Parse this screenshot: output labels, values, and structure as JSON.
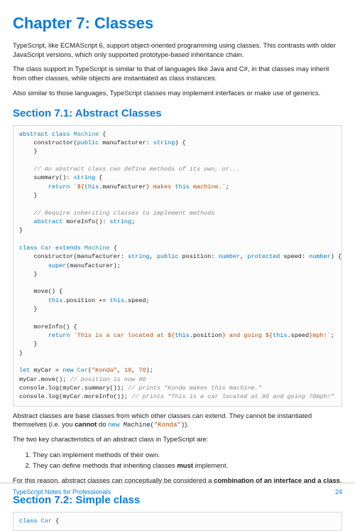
{
  "chapter_title": "Chapter 7: Classes",
  "p1": "TypeScript, like ECMAScript 6, support object-oriented programming using classes. This contrasts with older JavaScript versions, which only supported prototype-based inheritance chain.",
  "p2": "The class support in TypeScript is similar to that of languages like Java and C#, in that classes may inherit from other classes, while objects are instantiated as class instances.",
  "p3": "Also similar to those languages, TypeScript classes may implement interfaces or make use of generics.",
  "section1": "Section 7.1: Abstract Classes",
  "p4a": "Abstract classes are base classes from which other classes can extend. They cannot be instantiated themselves (i.e. you ",
  "p4b": "cannot",
  "p4c": " do ",
  "p4d_kw1": "new",
  "p4d_rest": " Machine(",
  "p4d_str": "\"Konda\"",
  "p4d_close": ")",
  "p4e": ").",
  "p5": "The two key characteristics of an abstract class in TypeScript are:",
  "li1": "They can implement methods of their own.",
  "li2a": "They can define methods that inheriting classes ",
  "li2b": "must",
  "li2c": " implement.",
  "p6a": "For this reason, abstract classes can conceptually be considered a ",
  "p6b": "combination of an interface and a class",
  "p6c": ".",
  "section2": "Section 7.2: Simple class",
  "footer_text": "TypeScript Notes for Professionals",
  "page_number": "24"
}
